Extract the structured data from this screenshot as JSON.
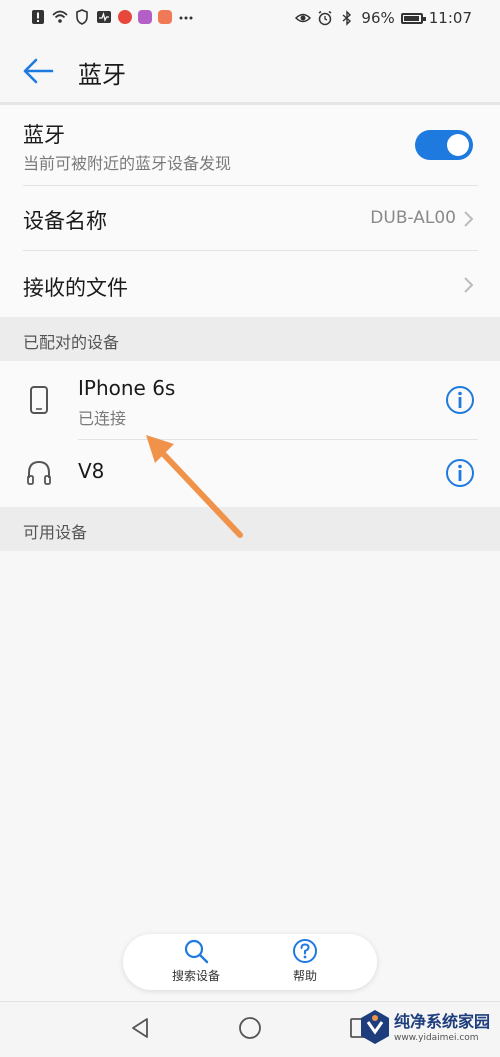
{
  "status_bar": {
    "battery_percent": "96%",
    "time": "11:07"
  },
  "header": {
    "title": "蓝牙"
  },
  "bluetooth": {
    "label": "蓝牙",
    "subtitle": "当前可被附近的蓝牙设备发现",
    "enabled": true
  },
  "device_name": {
    "label": "设备名称",
    "value": "DUB-AL00"
  },
  "received_files": {
    "label": "接收的文件"
  },
  "paired_section": {
    "title": "已配对的设备",
    "devices": [
      {
        "name": "IPhone 6s",
        "status": "已连接",
        "icon": "phone-icon"
      },
      {
        "name": "V8",
        "status": "",
        "icon": "headphones-icon"
      }
    ]
  },
  "available_section": {
    "title": "可用设备"
  },
  "bottom_actions": {
    "search_label": "搜索设备",
    "help_label": "帮助"
  },
  "watermark": {
    "text": "纯净系统家园",
    "url": "www.yidaimei.com"
  },
  "colors": {
    "accent": "#1f7ae0",
    "annotation": "#f0924a"
  }
}
